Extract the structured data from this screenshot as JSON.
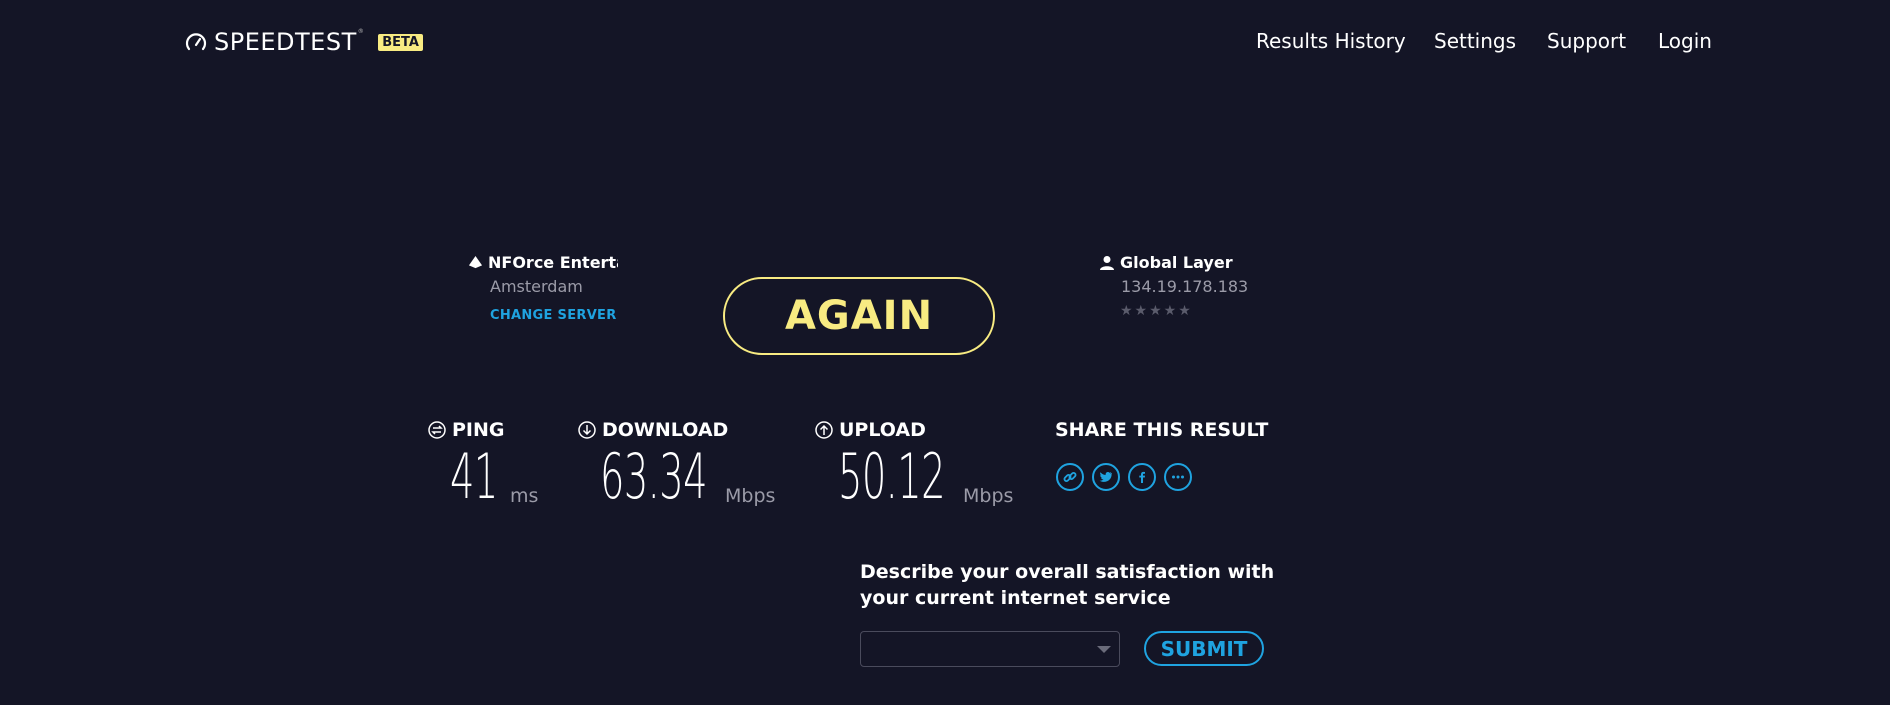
{
  "header": {
    "logo_text": "SPEEDTEST",
    "trademark": "®",
    "badge": "BETA",
    "nav": [
      "Results History",
      "Settings",
      "Support",
      "Login"
    ]
  },
  "server": {
    "icon": "server-pin-icon",
    "name": "NFOrce Enterta",
    "location": "Amsterdam",
    "change_label": "CHANGE SERVER"
  },
  "isp": {
    "icon": "user-icon",
    "name": "Global Layer",
    "ip": "134.19.178.183",
    "rating_stars": "★★★★★",
    "rating_value": 0
  },
  "again_label": "AGAIN",
  "metrics": {
    "ping": {
      "label": "PING",
      "value": "41",
      "unit": "ms",
      "icon": "ping-icon"
    },
    "download": {
      "label": "DOWNLOAD",
      "value": "63.34",
      "unit": "Mbps",
      "icon": "download-icon"
    },
    "upload": {
      "label": "UPLOAD",
      "value": "50.12",
      "unit": "Mbps",
      "icon": "upload-icon"
    }
  },
  "share": {
    "title": "SHARE THIS RESULT",
    "icons": [
      "link-icon",
      "twitter-icon",
      "facebook-icon",
      "more-icon"
    ]
  },
  "survey": {
    "question": "Describe your overall satisfaction with your current internet service",
    "select_value": "",
    "submit_label": "SUBMIT"
  },
  "colors": {
    "background": "#141526",
    "accent_yellow": "#f8eb82",
    "accent_blue": "#1fa3e0",
    "muted_text": "#9b9ba8"
  }
}
